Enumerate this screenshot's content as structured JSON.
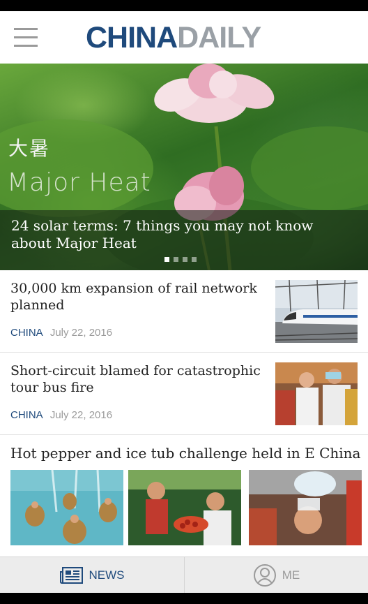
{
  "header": {
    "logo_part1": "CHINA",
    "logo_part2": "DAILY"
  },
  "hero": {
    "overlay_cn": "大暑",
    "overlay_en": "Major Heat",
    "title": "24 solar terms: 7 things you may not know about Major Heat",
    "slide_count": 4,
    "active_slide": 1
  },
  "articles": [
    {
      "title": "30,000 km expansion of rail network planned",
      "category": "CHINA",
      "date": "July 22, 2016"
    },
    {
      "title": "Short-circuit blamed for catastrophic tour bus fire",
      "category": "CHINA",
      "date": "July 22, 2016"
    }
  ],
  "gallery": {
    "title": "Hot pepper and ice tub challenge held in E China"
  },
  "bottom_nav": {
    "news_label": "NEWS",
    "me_label": "ME"
  },
  "colors": {
    "brand_blue": "#1f4a7c",
    "logo_gray": "#9aa0a6"
  }
}
